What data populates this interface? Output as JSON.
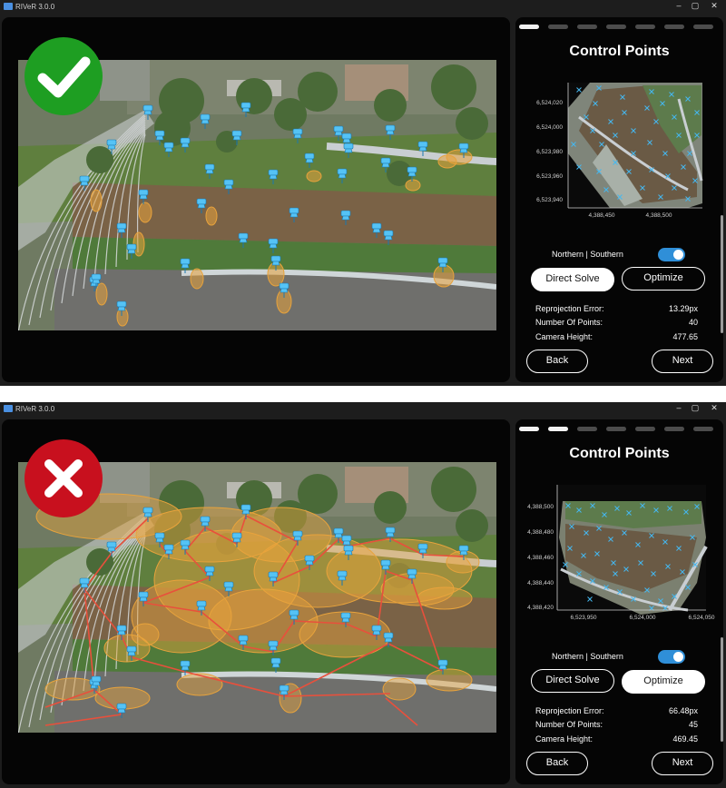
{
  "app": {
    "title": "RIVeR 3.0.0"
  },
  "window_controls": [
    "–",
    "▢",
    "✕"
  ],
  "top": {
    "status": "accepted",
    "badge_icon": "checkmark-icon",
    "badge_color": "#1e9e22",
    "panel": {
      "heading": "Control Points",
      "steps": [
        true,
        false,
        false,
        false,
        false,
        false,
        false
      ],
      "axes": {
        "x_ticks": [
          "4,388,450",
          "4,388,500"
        ],
        "y_ticks": [
          "6,524,020",
          "6,524,000",
          "6,523,980",
          "6,523,960",
          "6,523,940"
        ]
      },
      "toggle_label": "Northern | Southern",
      "direct_solve": "Direct Solve",
      "optimize": "Optimize",
      "stats": [
        {
          "label": "Reprojection Error:",
          "value": "13.29px"
        },
        {
          "label": "Number Of Points:",
          "value": "40"
        },
        {
          "label": "Camera Height:",
          "value": "477.65"
        }
      ],
      "back": "Back",
      "next": "Next"
    }
  },
  "bottom": {
    "status": "rejected",
    "badge_icon": "x-icon",
    "badge_color": "#c8101e",
    "panel": {
      "heading": "Control Points",
      "steps": [
        true,
        true,
        false,
        false,
        false,
        false,
        false
      ],
      "axes": {
        "x_ticks": [
          "6,523,950",
          "6,524,000",
          "6,524,050"
        ],
        "y_ticks": [
          "4,388,500",
          "4,388,480",
          "4,388,460",
          "4,388,440",
          "4,388,420"
        ]
      },
      "toggle_label": "Northern | Southern",
      "direct_solve": "Direct Solve",
      "optimize": "Optimize",
      "stats": [
        {
          "label": "Reprojection Error:",
          "value": "66.48px"
        },
        {
          "label": "Number Of Points:",
          "value": "45"
        },
        {
          "label": "Camera Height:",
          "value": "469.45"
        }
      ],
      "back": "Back",
      "next": "Next"
    }
  },
  "colors": {
    "pin": "#55c3f5",
    "ellipse": "#e8a33c",
    "error_line": "#e8503c",
    "toggle": "#2f8fd8",
    "marker": "#45b8f0"
  }
}
